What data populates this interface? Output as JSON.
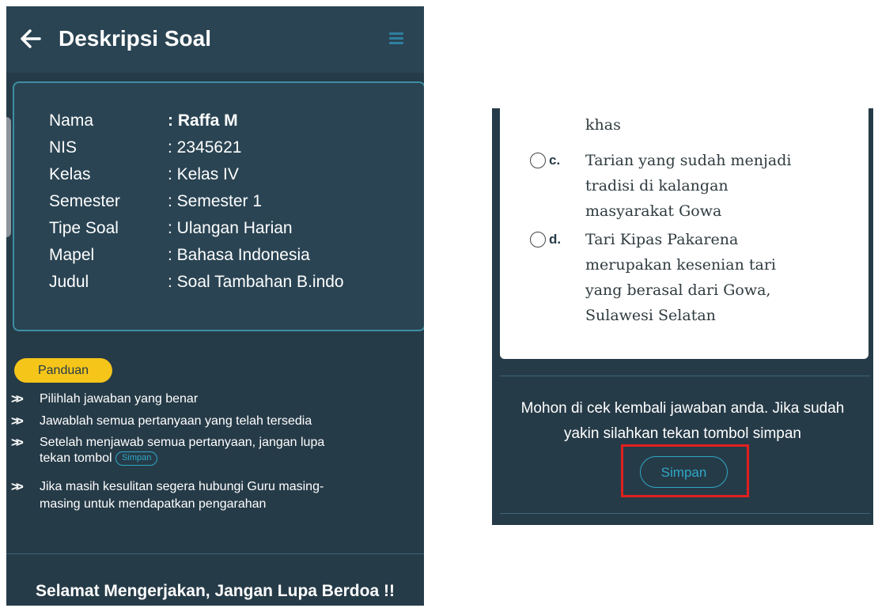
{
  "header": {
    "title": "Deskripsi Soal",
    "back_icon": "arrow-left-icon",
    "menu_icon": "hamburger-menu-icon"
  },
  "student_info": [
    {
      "label": "Nama",
      "value": ": Raffa M"
    },
    {
      "label": "NIS",
      "value": ": 2345621"
    },
    {
      "label": "Kelas",
      "value": ": Kelas IV"
    },
    {
      "label": "Semester",
      "value": ": Semester 1"
    },
    {
      "label": "Tipe Soal",
      "value": ": Ulangan Harian"
    },
    {
      "label": "Mapel",
      "value": ": Bahasa Indonesia"
    },
    {
      "label": "Judul",
      "value": ": Soal Tambahan B.indo"
    }
  ],
  "guide": {
    "badge": "Panduan",
    "items": [
      "Pilihlah jawaban yang benar",
      "Jawablah semua pertanyaan yang telah tersedia",
      "Setelah menjawab semua pertanyaan, jangan lupa",
      "tekan tombol",
      "Jika masih kesulitan segera hubungi Guru masing-",
      "masing untuk mendapatkan pengarahan"
    ],
    "inline_button": "Simpan"
  },
  "footer": {
    "message": "Selamat Mengerjakan, Jangan Lupa Berdoa !!"
  },
  "question": {
    "prev_fragment": "khas",
    "options": [
      {
        "letter": "c.",
        "lines": [
          "Tarian yang sudah menjadi",
          "tradisi di kalangan",
          "masyarakat Gowa"
        ]
      },
      {
        "letter": "d.",
        "lines": [
          "Tari Kipas Pakarena",
          "merupakan kesenian tari",
          "yang berasal dari Gowa,",
          "Sulawesi Selatan"
        ]
      }
    ]
  },
  "confirm": {
    "line1": "Mohon di cek kembali jawaban anda. Jika sudah",
    "line2": "yakin silahkan tekan tombol simpan",
    "button": "Simpan"
  },
  "colors": {
    "panel_bg": "#263b48",
    "accent": "#2fa8c6",
    "badge": "#f5c51a",
    "highlight": "#e02020"
  }
}
